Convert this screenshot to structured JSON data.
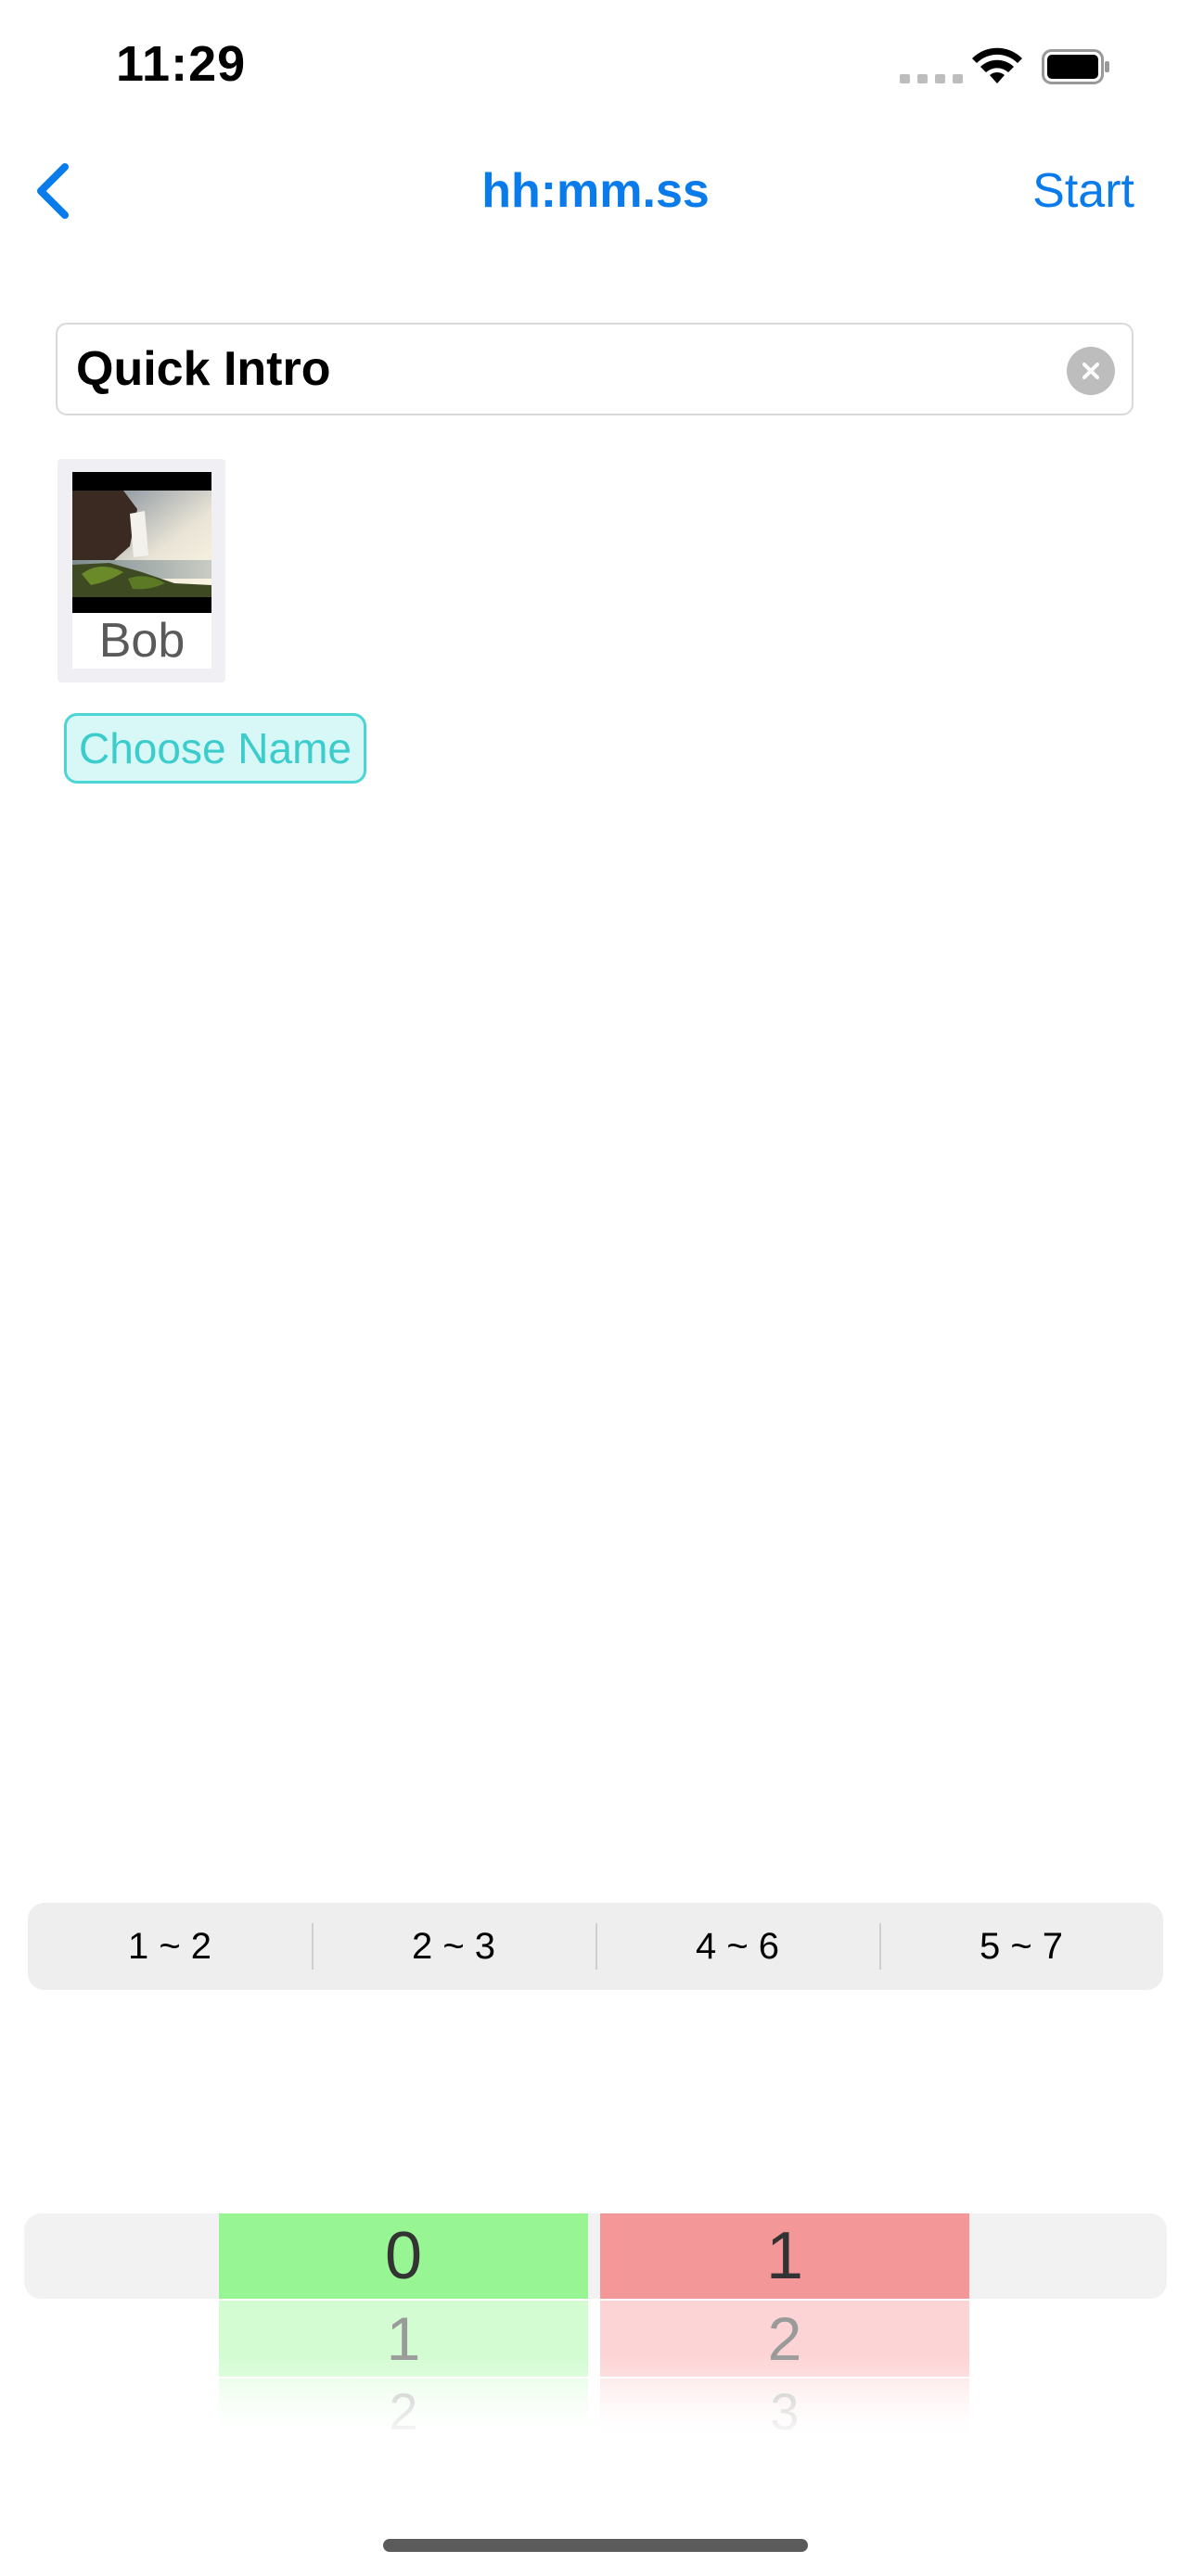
{
  "status_bar": {
    "time": "11:29"
  },
  "nav": {
    "title": "hh:mm.ss",
    "start_label": "Start",
    "accent_color": "#0a7bea"
  },
  "title_field": {
    "value": "Quick Intro",
    "clear_icon": "clear-circle-icon"
  },
  "person": {
    "name": "Bob",
    "photo": "waterfall-landscape-photo"
  },
  "choose_name": {
    "label": "Choose Name",
    "color": "#3ccccc"
  },
  "segmented": {
    "options": [
      "1 ~ 2",
      "2 ~ 3",
      "4 ~ 6",
      "5 ~ 7"
    ]
  },
  "picker": {
    "left": {
      "selected": "0",
      "next": [
        "1",
        "2"
      ],
      "color": "#98f594"
    },
    "right": {
      "selected": "1",
      "next": [
        "2",
        "3"
      ],
      "color": "#f39798"
    }
  }
}
